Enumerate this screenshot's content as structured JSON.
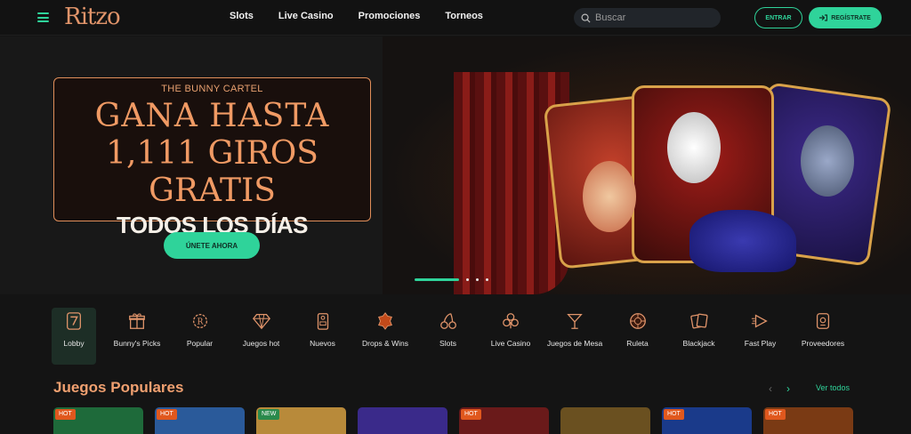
{
  "header": {
    "logo": "Ritzo",
    "nav": [
      "Slots",
      "Live Casino",
      "Promociones",
      "Torneos"
    ],
    "search_placeholder": "Buscar",
    "login_label": "ENTRAR",
    "register_label": "REGÍSTRATE"
  },
  "hero": {
    "subtitle": "THE BUNNY CARTEL",
    "line1": "GANA HASTA",
    "line2": "1,111 GIROS GRATIS",
    "line3": "TODOS LOS DÍAS",
    "cta": "ÚNETE AHORA",
    "slides_total": 4,
    "slide_active": 1
  },
  "categories": [
    {
      "label": "Lobby",
      "icon": "seven-icon",
      "active": true
    },
    {
      "label": "Bunny's Picks",
      "icon": "gift-icon"
    },
    {
      "label": "Popular",
      "icon": "laurel-icon"
    },
    {
      "label": "Juegos hot",
      "icon": "diamond-icon"
    },
    {
      "label": "Nuevos",
      "icon": "door-tag-icon"
    },
    {
      "label": "Drops & Wins",
      "icon": "drops-wins-icon"
    },
    {
      "label": "Slots",
      "icon": "cherry-icon"
    },
    {
      "label": "Live Casino",
      "icon": "clubs-icon"
    },
    {
      "label": "Juegos de Mesa",
      "icon": "cocktail-icon"
    },
    {
      "label": "Ruleta",
      "icon": "roulette-icon"
    },
    {
      "label": "Blackjack",
      "icon": "cards-icon"
    },
    {
      "label": "Fast Play",
      "icon": "fast-play-icon"
    },
    {
      "label": "Proveedores",
      "icon": "provider-icon"
    }
  ],
  "popular": {
    "title": "Juegos Populares",
    "see_all": "Ver todos",
    "games": [
      {
        "badge": "HOT",
        "color": "#1e6a3a"
      },
      {
        "badge": "HOT",
        "color": "#2a5a9a"
      },
      {
        "badge": "NEW",
        "color": "#b88a3a"
      },
      {
        "badge": "",
        "color": "#3a2a8a"
      },
      {
        "badge": "HOT",
        "color": "#6a1a1a"
      },
      {
        "badge": "",
        "color": "#6a5020"
      },
      {
        "badge": "HOT",
        "color": "#1a3a8a"
      },
      {
        "badge": "HOT",
        "color": "#7a3a14"
      }
    ]
  },
  "colors": {
    "accent": "#2fd39a",
    "brand": "#f09a64",
    "hot": "#e0581e",
    "new": "#2a8a4c"
  }
}
